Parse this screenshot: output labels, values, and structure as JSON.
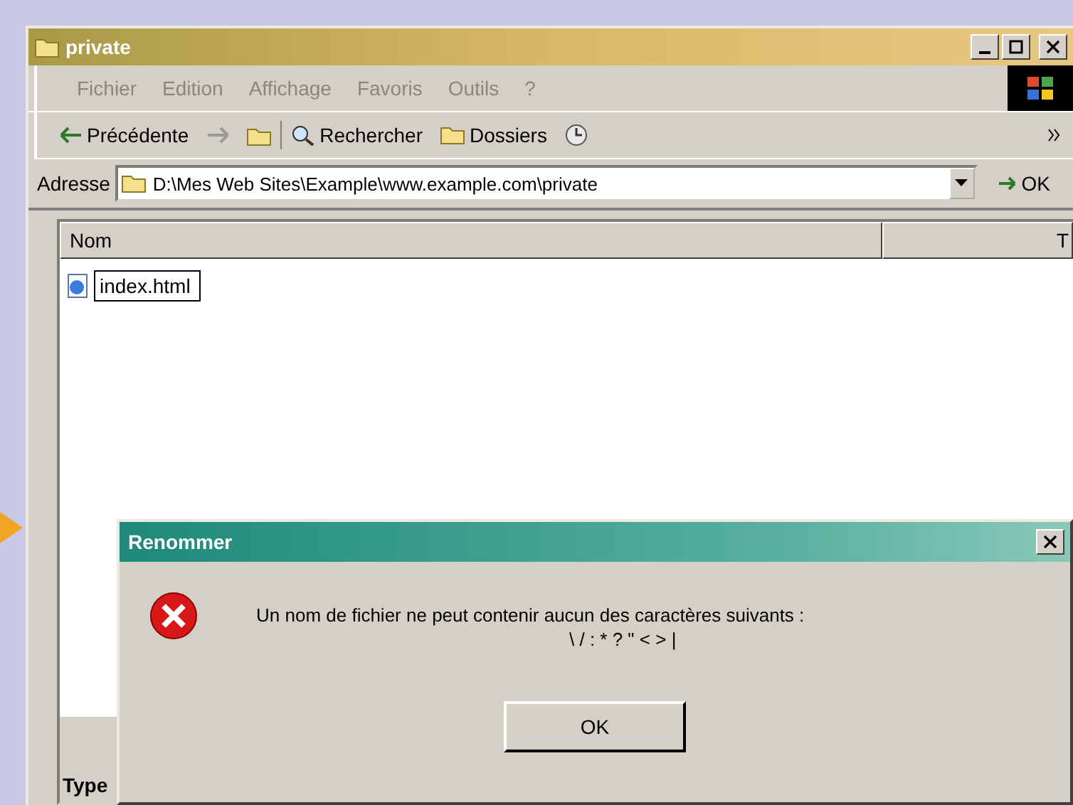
{
  "window": {
    "title": "private"
  },
  "menu": [
    "Fichier",
    "Edition",
    "Affichage",
    "Favoris",
    "Outils",
    "?"
  ],
  "toolbar": [
    {
      "kind": "back",
      "label": "Précédente"
    },
    {
      "kind": "forward"
    },
    {
      "kind": "up"
    },
    {
      "kind": "search",
      "label": "Rechercher"
    },
    {
      "kind": "folders",
      "label": "Dossiers"
    },
    {
      "kind": "history"
    }
  ],
  "address": {
    "label": "Adresse",
    "value": "D:\\Mes Web Sites\\Example\\www.example.com\\private",
    "go": "OK"
  },
  "columns": [
    "Nom",
    "T"
  ],
  "files": [
    {
      "name": "index.html",
      "renaming": true
    }
  ],
  "details_panel": {
    "label": "Type"
  },
  "dialog": {
    "title": "Renommer",
    "message": [
      "Un nom de fichier ne peut contenir aucun des caractères suivants :",
      "\\ / : * ? \" < > |"
    ],
    "button": "OK"
  }
}
